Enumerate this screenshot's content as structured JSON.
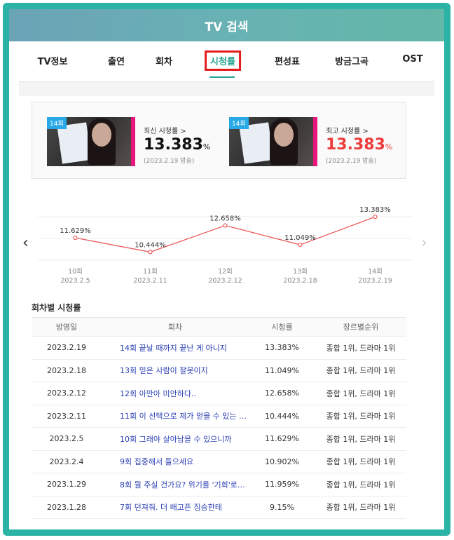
{
  "window": {
    "title": "TV 검색"
  },
  "tabs": [
    {
      "label": "TV정보"
    },
    {
      "label": "출연"
    },
    {
      "label": "회차"
    },
    {
      "label": "시청률"
    },
    {
      "label": "편성표"
    },
    {
      "label": "방금그곡"
    },
    {
      "label": "OST"
    }
  ],
  "active_tab": "시청률",
  "summary": {
    "latest": {
      "badge": "14회",
      "label": "최신 시청률 >",
      "value": "13.383",
      "unit": "%",
      "date": "(2023.2.19 방송)"
    },
    "highest": {
      "badge": "14회",
      "label": "최고 시청률 >",
      "value": "13.383",
      "unit": "%",
      "date": "(2023.2.19 방송)"
    },
    "highlight_color": "#ec3c3c"
  },
  "chart_data": {
    "type": "line",
    "categories": [
      "10회\n2023.2.5",
      "11회\n2023.2.11",
      "12회\n2023.2.12",
      "13회\n2023.2.18",
      "14회\n2023.2.19"
    ],
    "episodes": [
      "10회",
      "11회",
      "12회",
      "13회",
      "14회"
    ],
    "dates": [
      "2023.2.5",
      "2023.2.11",
      "2023.2.12",
      "2023.2.18",
      "2023.2.19"
    ],
    "values": [
      11.629,
      10.444,
      12.658,
      11.049,
      13.383
    ],
    "labels": [
      "11.629%",
      "10.444%",
      "12.658%",
      "11.049%",
      "13.383%"
    ],
    "color": "#ec5a5a",
    "grid": true,
    "nav": {
      "prev": "‹",
      "next": "›"
    }
  },
  "episode_ratings": {
    "title": "회차별 시청률",
    "columns": [
      "방영일",
      "회차",
      "시청률",
      "장르별순위"
    ],
    "rows": [
      [
        "2023.2.19",
        "14회 끝날 때까지 끝난 게 아니지",
        "13.383%",
        "종합 1위, 드라마 1위"
      ],
      [
        "2023.2.18",
        "13회 믿은 사람이 잘못이지",
        "11.049%",
        "종합 1위, 드라마 1위"
      ],
      [
        "2023.2.12",
        "12회 아만아 미안하다..",
        "12.658%",
        "종합 1위, 드라마 1위"
      ],
      [
        "2023.2.11",
        "11회 이 선택으로 제가 얻을 수 있는 …",
        "10.444%",
        "종합 1위, 드라마 1위"
      ],
      [
        "2023.2.5",
        "10회 그래야 살아남을 수 있으니까",
        "11.629%",
        "종합 1위, 드라마 1위"
      ],
      [
        "2023.2.4",
        "9회 집중해서 들으세요",
        "10.902%",
        "종합 1위, 드라마 1위"
      ],
      [
        "2023.1.29",
        "8회 뭘 주실 건가요? 위기를 '기회'로…",
        "11.959%",
        "종합 1위, 드라마 1위"
      ],
      [
        "2023.1.28",
        "7회 던져줘. 더 배고픈 짐승한테",
        "9.15%",
        "종합 1위, 드라마 1위"
      ]
    ]
  }
}
